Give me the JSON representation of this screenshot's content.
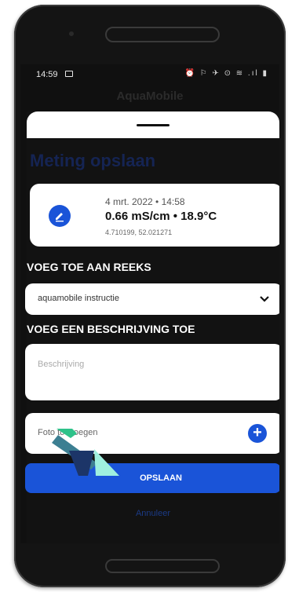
{
  "statusbar": {
    "time": "14:59",
    "icons": "⏰ ⚐ ✈ ⊙ ≋ .ıl ▮"
  },
  "app": {
    "title": "AquaMobile"
  },
  "sheet": {
    "title": "Meting opslaan",
    "measurement": {
      "date": "4 mrt. 2022 • 14:58",
      "reading": "0.66 mS/cm • 18.9°C",
      "coordinates": "4.710199, 52.021271"
    },
    "series_label": "VOEG TOE AAN REEKS",
    "series_value": "aquamobile instructie",
    "description_label": "VOEG EEN BESCHRIJVING TOE",
    "description_placeholder": "Beschrijving",
    "photo_label": "Foto toevoegen",
    "save_label": "OPSLAAN",
    "cancel_label": "Annuleer"
  },
  "colors": {
    "accent": "#1a54d8",
    "title": "#152453",
    "background": "#121212"
  }
}
